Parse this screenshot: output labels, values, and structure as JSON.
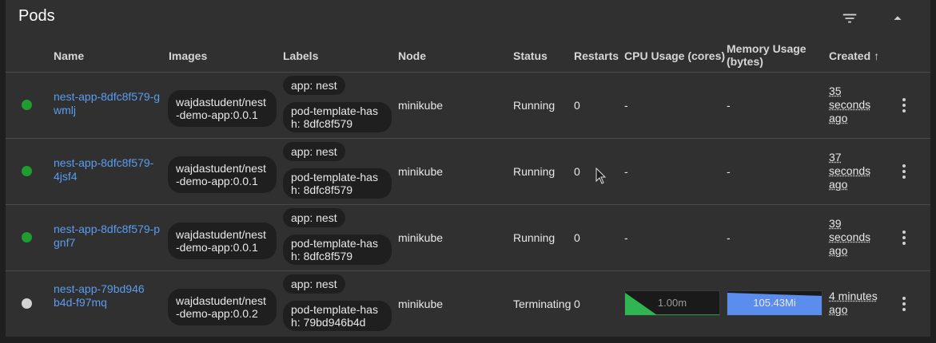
{
  "card": {
    "title": "Pods",
    "filter_icon": "filter-list-icon",
    "collapse_icon": "arrow-drop-up-icon"
  },
  "columns": {
    "name": "Name",
    "images": "Images",
    "labels": "Labels",
    "node": "Node",
    "status": "Status",
    "restarts": "Restarts",
    "cpu": "CPU Usage (cores)",
    "memory": "Memory Usage (bytes)",
    "created": "Created",
    "created_sort": "↑"
  },
  "rows": [
    {
      "status_color": "#1e9e2e",
      "name": "nest-app-8dfc8f579-gwmlj",
      "image": "wajdastudent/nest-demo-app:0.0.1",
      "label_1": "app: nest",
      "label_2": "pod-template-hash: 8dfc8f579",
      "node": "minikube",
      "status": "Running",
      "restarts": "0",
      "cpu": "-",
      "memory": "-",
      "created": "35 seconds ago"
    },
    {
      "status_color": "#1e9e2e",
      "name": "nest-app-8dfc8f579-4jsf4",
      "image": "wajdastudent/nest-demo-app:0.0.1",
      "label_1": "app: nest",
      "label_2": "pod-template-hash: 8dfc8f579",
      "node": "minikube",
      "status": "Running",
      "restarts": "0",
      "cpu": "-",
      "memory": "-",
      "created": "37 seconds ago"
    },
    {
      "status_color": "#1e9e2e",
      "name": "nest-app-8dfc8f579-pgnf7",
      "image": "wajdastudent/nest-demo-app:0.0.1",
      "label_1": "app: nest",
      "label_2": "pod-template-hash: 8dfc8f579",
      "node": "minikube",
      "status": "Running",
      "restarts": "0",
      "cpu": "-",
      "memory": "-",
      "created": "39 seconds ago"
    },
    {
      "status_color": "#d3d3d3",
      "name": "nest-app-79bd946b4d-f97mq",
      "image": "wajdastudent/nest-demo-app:0.0.2",
      "label_1": "app: nest",
      "label_2": "pod-template-hash: 79bd946b4d",
      "node": "minikube",
      "status": "Terminating",
      "restarts": "0",
      "cpu": "1.00m",
      "memory": "105.43Mi",
      "created": "4 minutes ago"
    }
  ],
  "colors": {
    "cpu_spark": "#2fb552",
    "memory_spark": "#5b8def",
    "link": "#5b9cf0"
  },
  "row_menu_icon": "more-vert-icon"
}
